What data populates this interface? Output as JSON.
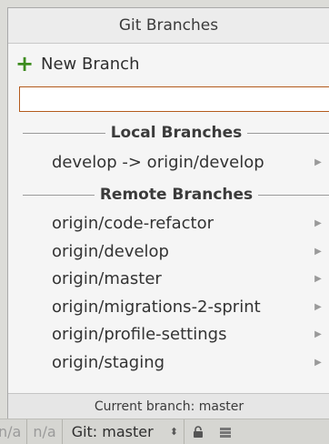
{
  "popup": {
    "title": "Git Branches",
    "new_branch_icon": "plus-icon",
    "new_branch_label": "New Branch",
    "search": {
      "value": "",
      "placeholder": ""
    },
    "local_header": "Local Branches",
    "local_branches": [
      {
        "label": "develop -> origin/develop"
      }
    ],
    "remote_header": "Remote Branches",
    "remote_branches": [
      {
        "label": "origin/code-refactor"
      },
      {
        "label": "origin/develop"
      },
      {
        "label": "origin/master"
      },
      {
        "label": "origin/migrations-2-sprint"
      },
      {
        "label": "origin/profile-settings"
      },
      {
        "label": "origin/staging"
      }
    ],
    "footer": "Current branch: master"
  },
  "statusbar": {
    "cell1": "n/a",
    "cell2": "n/a",
    "git_label": "Git: master",
    "git_arrows": "⬍",
    "lock_icon": "lock-icon",
    "db_icon": "database-icon"
  },
  "colors": {
    "accent_plus": "#3d8c1f",
    "search_border": "#b35a1c"
  }
}
